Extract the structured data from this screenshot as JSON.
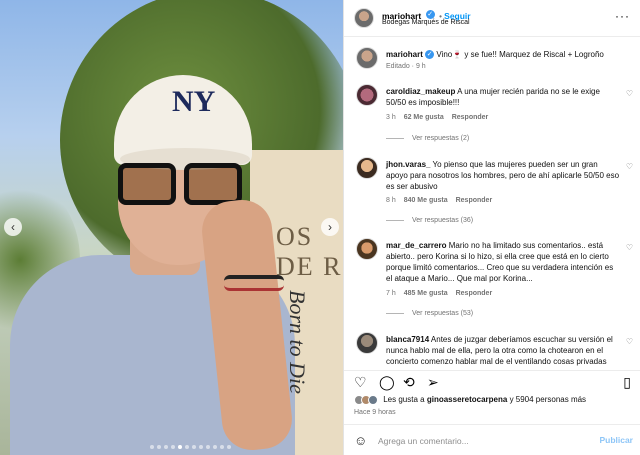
{
  "header": {
    "username": "mariohart",
    "follow_label": "Seguir",
    "location": "Bodegas Marqués de Riscal",
    "more_icon": "more-icon"
  },
  "caption": {
    "username": "mariohart",
    "text": "Vino🍷 y se fue!! Marquez de Riscal + Logroño",
    "meta": "Editado · 9 h"
  },
  "comments": [
    {
      "username": "caroldiaz_makeup",
      "text": "A una mujer recién parida no se le exige 50/50 es imposible!!!",
      "age": "3 h",
      "likes": "62 Me gusta",
      "reply": "Responder",
      "replies": "Ver respuestas (2)"
    },
    {
      "username": "jhon.varas_",
      "text": "Yo pienso que las mujeres pueden ser un gran apoyo para nosotros los hombres, pero de ahí aplicarle 50/50 eso es ser abusivo",
      "age": "8 h",
      "likes": "840 Me gusta",
      "reply": "Responder",
      "replies": "Ver respuestas (36)"
    },
    {
      "username": "mar_de_carrero",
      "text": "Mario no ha limitado sus comentarios.. está abierto.. pero Korina si lo hizo, si ella cree que está en lo cierto porque limitó comentarios... Creo que su verdadera intención es el ataque a Mario... Que mal por Korina...",
      "age": "7 h",
      "likes": "485 Me gusta",
      "reply": "Responder",
      "replies": "Ver respuestas (53)"
    },
    {
      "username": "blanca7914",
      "text": "Antes de juzgar deberíamos escuchar su versión el nunca hablo mal de ella, pero la otra como la chotearon en el concierto comenzo hablar mal de el ventilando cosas privadas"
    }
  ],
  "likes": {
    "prefix": "Les gusta a",
    "user": "ginoasseretocarpena",
    "suffix": "y 5904 personas más"
  },
  "timestamp": "Hace 9 horas",
  "comment_box": {
    "placeholder": "Agrega un comentario...",
    "post_label": "Publicar"
  },
  "photo": {
    "sign_text": "OS DE R",
    "tattoo_text": "Born to Die"
  },
  "icons": [
    "heart-icon",
    "comment-icon",
    "repost-icon",
    "share-icon",
    "bookmark-icon",
    "smile-icon"
  ],
  "colors": {
    "follow": "#0095f6",
    "verified": "#3897f0",
    "post_disabled": "#8ec6f7"
  }
}
